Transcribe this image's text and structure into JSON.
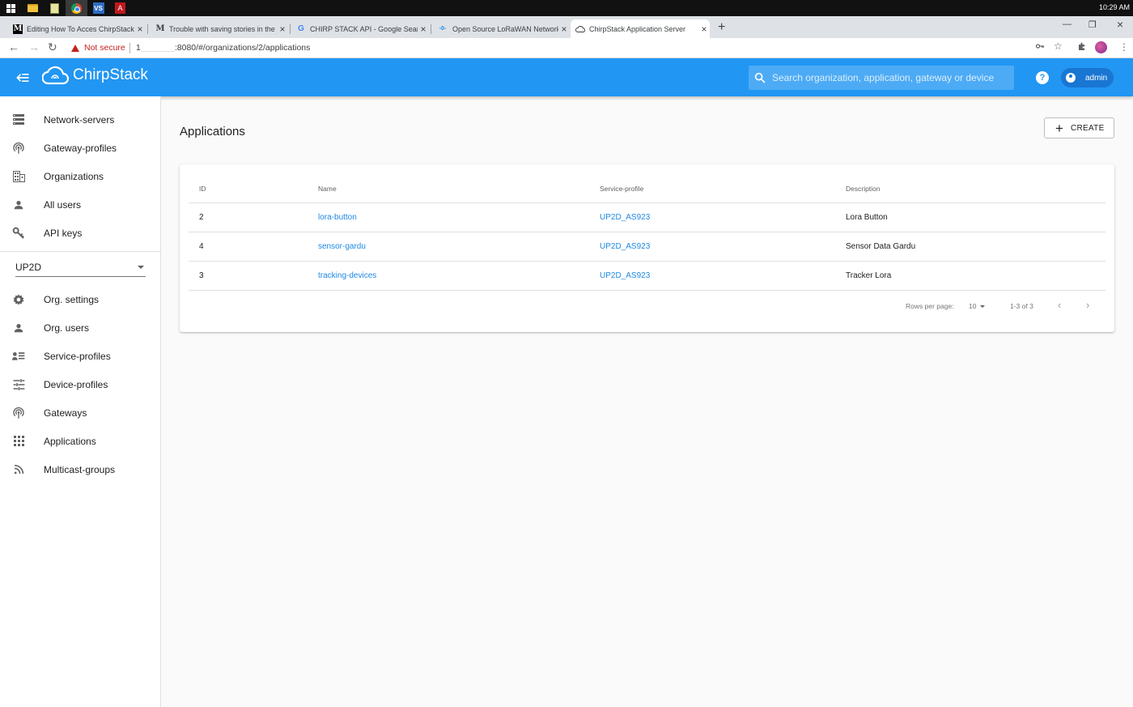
{
  "taskbar": {
    "clock": "10:29 AM",
    "apps": [
      "windows-start",
      "file-explorer",
      "sticky-notes",
      "chrome",
      "visual-studio",
      "acrobat"
    ]
  },
  "browser": {
    "tabs": [
      {
        "label": "Editing How To Acces ChirpStack",
        "favicon": "M"
      },
      {
        "label": "Trouble with saving stories in the",
        "favicon": "M"
      },
      {
        "label": "CHIRP STACK API - Google Search",
        "favicon": "G"
      },
      {
        "label": "Open Source LoRaWAN Network",
        "favicon": "-0-"
      },
      {
        "label": "ChirpStack Application Server",
        "favicon": "cloud"
      }
    ],
    "active_tab": 4,
    "security": "Not secure",
    "url_redacted_prefix": "1",
    "url": ":8080/#/organizations/2/applications"
  },
  "appbar": {
    "brand": "ChirpStack",
    "search_placeholder": "Search organization, application, gateway or device",
    "help": "?",
    "user": "admin",
    "color": "#2196f3"
  },
  "sidebar": {
    "global_items": [
      {
        "label": "Network-servers",
        "icon": "server-icon"
      },
      {
        "label": "Gateway-profiles",
        "icon": "antenna-icon"
      },
      {
        "label": "Organizations",
        "icon": "building-icon"
      },
      {
        "label": "All users",
        "icon": "person-icon"
      },
      {
        "label": "API keys",
        "icon": "key-icon"
      }
    ],
    "org_selected": "UP2D",
    "org_items": [
      {
        "label": "Org. settings",
        "icon": "gear-icon"
      },
      {
        "label": "Org. users",
        "icon": "person-icon"
      },
      {
        "label": "Service-profiles",
        "icon": "account-list-icon"
      },
      {
        "label": "Device-profiles",
        "icon": "tune-icon"
      },
      {
        "label": "Gateways",
        "icon": "antenna-icon"
      },
      {
        "label": "Applications",
        "icon": "apps-grid-icon"
      },
      {
        "label": "Multicast-groups",
        "icon": "rss-icon"
      }
    ]
  },
  "main": {
    "title": "Applications",
    "create_label": "CREATE",
    "table": {
      "columns": [
        "ID",
        "Name",
        "Service-profile",
        "Description"
      ],
      "rows": [
        {
          "id": "2",
          "name": "lora-button",
          "service_profile": "UP2D_AS923",
          "description": "Lora Button"
        },
        {
          "id": "4",
          "name": "sensor-gardu",
          "service_profile": "UP2D_AS923",
          "description": "Sensor Data Gardu"
        },
        {
          "id": "3",
          "name": "tracking-devices",
          "service_profile": "UP2D_AS923",
          "description": "Tracker Lora"
        }
      ]
    },
    "pagination": {
      "rows_per_page_label": "Rows per page:",
      "rows_per_page": "10",
      "range": "1-3 of 3"
    }
  }
}
